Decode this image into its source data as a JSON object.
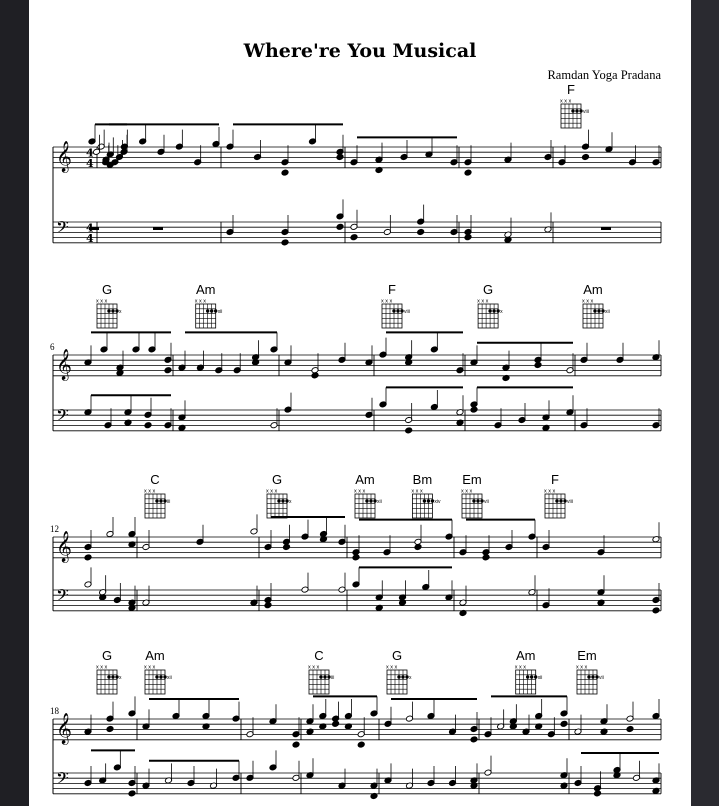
{
  "score": {
    "title": "Where're You Musical",
    "composer": "Ramdan Yoga Pradana",
    "time_signature": {
      "top": "4",
      "bottom": "4"
    }
  },
  "systems": [
    {
      "measure_number": "",
      "chords": [
        {
          "name": "F",
          "fret": "viii",
          "measure": 5,
          "frac": 0.0
        }
      ]
    },
    {
      "measure_number": "6",
      "chords": [
        {
          "name": "G",
          "fret": "x",
          "measure": 0,
          "frac": 0.0
        },
        {
          "name": "Am",
          "fret": "xii",
          "measure": 1,
          "frac": 0.15
        },
        {
          "name": "F",
          "fret": "viii",
          "measure": 3,
          "frac": 0.0
        },
        {
          "name": "G",
          "fret": "x",
          "measure": 4,
          "frac": 0.05
        },
        {
          "name": "Am",
          "fret": "xii",
          "measure": 5,
          "frac": 0.0
        }
      ]
    },
    {
      "measure_number": "12",
      "chords": [
        {
          "name": "C",
          "fret": "iii",
          "measure": 1,
          "frac": 0.0
        },
        {
          "name": "G",
          "fret": "x",
          "measure": 2,
          "frac": 0.0
        },
        {
          "name": "Am",
          "fret": "xii",
          "measure": 3,
          "frac": 0.0
        },
        {
          "name": "Bm",
          "fret": "xiv",
          "measure": 3,
          "frac": 0.58
        },
        {
          "name": "Em",
          "fret": "vii",
          "measure": 4,
          "frac": 0.0
        },
        {
          "name": "F",
          "fret": "viii",
          "measure": 5,
          "frac": 0.0
        }
      ]
    },
    {
      "measure_number": "18",
      "chords": [
        {
          "name": "G",
          "fret": "x",
          "measure": 0,
          "frac": 0.0
        },
        {
          "name": "Am",
          "fret": "xii",
          "measure": 1,
          "frac": 0.0
        },
        {
          "name": "C",
          "fret": "iii",
          "measure": 3,
          "frac": 0.0
        },
        {
          "name": "G",
          "fret": "x",
          "measure": 4,
          "frac": 0.0
        },
        {
          "name": "Am",
          "fret": "xii",
          "measure": 5,
          "frac": 0.35
        },
        {
          "name": "Em",
          "fret": "vii",
          "measure": 6,
          "frac": 0.0
        }
      ]
    }
  ],
  "diagram_muted_marks": "x x x"
}
